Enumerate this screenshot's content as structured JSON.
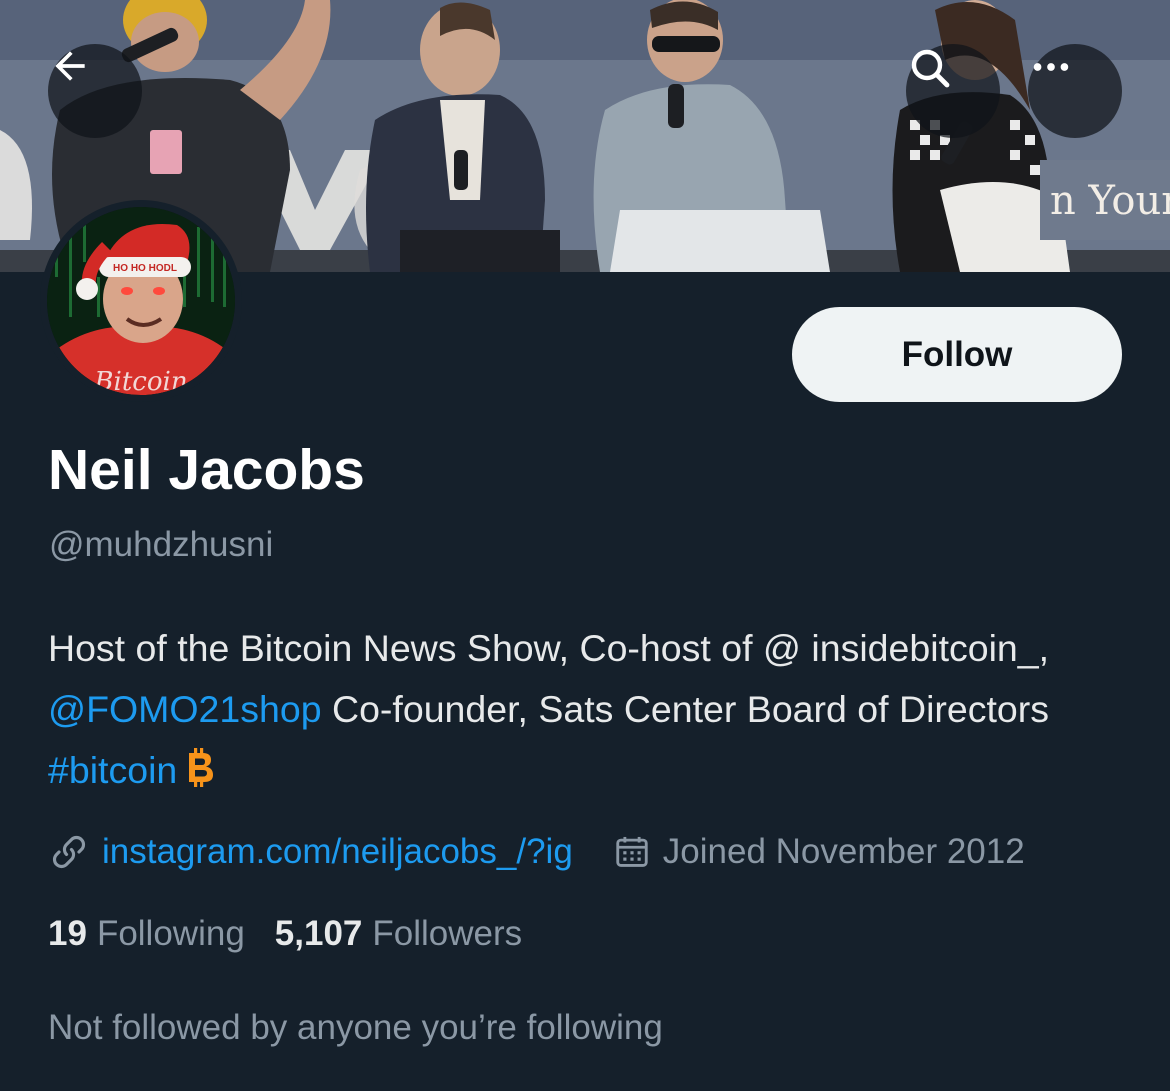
{
  "colors": {
    "background": "#15202b",
    "primary_text": "#e7e9ea",
    "secondary_text": "#8b98a5",
    "link": "#1d9bf0",
    "follow_button_bg": "#eff3f4",
    "bitcoin": "#f7931a"
  },
  "header": {
    "back_icon": "arrow-left-icon",
    "search_icon": "search-icon",
    "more_icon": "more-horizontal-icon",
    "banner_visible_text": "n Your"
  },
  "avatar": {
    "hat_text": "HO HO HODL",
    "shirt_text": "Bitcoin"
  },
  "profile": {
    "follow_label": "Follow",
    "display_name": "Neil Jacobs",
    "handle": "@muhdzhusni",
    "bio": {
      "part1": "Host of the Bitcoin News Show, Co-host of @ insidebitcoin_, ",
      "mention": "@FOMO21shop",
      "part2": " Co-founder, Sats Center Board of Directors ",
      "hashtag": "#bitcoin",
      "emoji_icon": "bitcoin-icon"
    },
    "website": "instagram.com/neiljacobs_/?ig",
    "website_icon": "link-icon",
    "joined": "Joined November 2012",
    "joined_icon": "calendar-icon",
    "following_count": "19",
    "following_label": "Following",
    "followers_count": "5,107",
    "followers_label": "Followers",
    "followed_by_text": "Not followed by anyone you’re following"
  }
}
